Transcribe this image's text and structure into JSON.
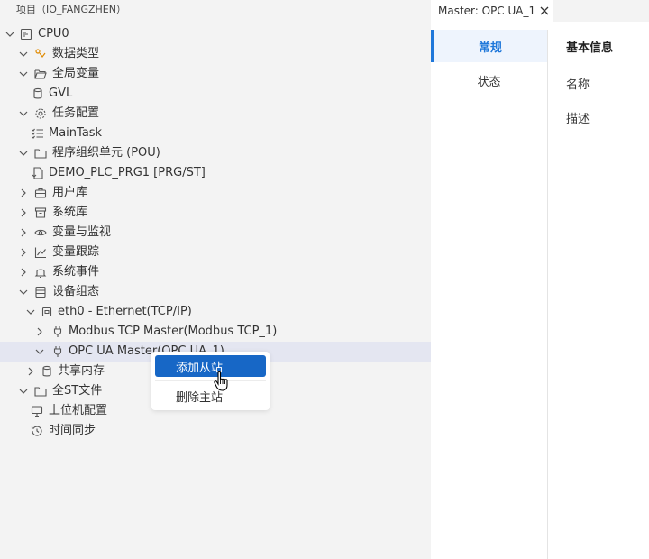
{
  "project": {
    "header": "项目（IO_FANGZHEN）"
  },
  "tree": {
    "cpu": "CPU0",
    "data_types": "数据类型",
    "global_vars": "全局变量",
    "gvl": "GVL",
    "task_config": "任务配置",
    "main_task": "MainTask",
    "pou": "程序组织单元 (POU)",
    "demo_prg": "DEMO_PLC_PRG1 [PRG/ST]",
    "user_lib": "用户库",
    "sys_lib": "系统库",
    "var_monitor": "变量与监视",
    "var_trace": "变量跟踪",
    "sys_events": "系统事件",
    "device_config": "设备组态",
    "eth0": "eth0 - Ethernet(TCP/IP)",
    "modbus_master": "Modbus TCP Master(Modbus TCP_1)",
    "opcua_master": "OPC UA Master(OPC UA_1)",
    "shared_mem": "共享内存",
    "all_st": "全ST文件",
    "host_config": "上位机配置",
    "time_sync": "时间同步"
  },
  "context_menu": {
    "add_slave": "添加从站",
    "delete_master": "删除主站"
  },
  "editor": {
    "tab_title": "Master: OPC UA_1",
    "nav": {
      "general": "常规",
      "status": "状态"
    },
    "form": {
      "section_title": "基本信息",
      "name_label": "名称",
      "desc_label": "描述"
    }
  },
  "colors": {
    "accent": "#1767c6",
    "nav_accent": "#1e77da",
    "highlight_row": "#e4e6f1",
    "icon_orange": "#e08a00"
  }
}
